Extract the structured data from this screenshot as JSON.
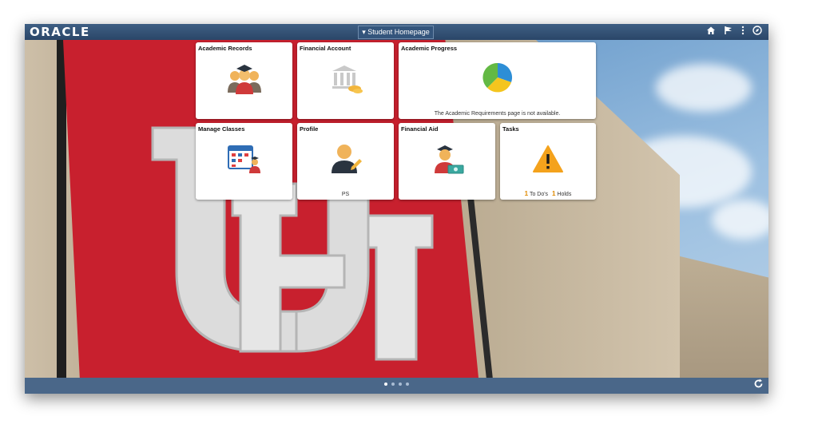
{
  "header": {
    "logo": "ORACLE",
    "homepage_label": "▾ Student Homepage"
  },
  "icons": [
    "home-icon",
    "flag-icon",
    "more-icon",
    "navbar-icon",
    "refresh-icon"
  ],
  "tiles": [
    {
      "title": "Academic Records",
      "footer": ""
    },
    {
      "title": "Financial Account",
      "footer": ""
    },
    {
      "title": "Academic Progress",
      "footer": "The Academic Requirements page is not available."
    },
    {
      "title": "Manage Classes",
      "footer": ""
    },
    {
      "title": "Profile",
      "footer": "PS"
    },
    {
      "title": "Financial Aid",
      "footer": ""
    },
    {
      "title": "Tasks",
      "todos_count": "1",
      "todos_label": "To Do's",
      "holds_count": "1",
      "holds_label": "Holds"
    }
  ],
  "colors": {
    "header": "#2a4668",
    "banner": "#c8202e",
    "warning": "#f4a21c"
  }
}
